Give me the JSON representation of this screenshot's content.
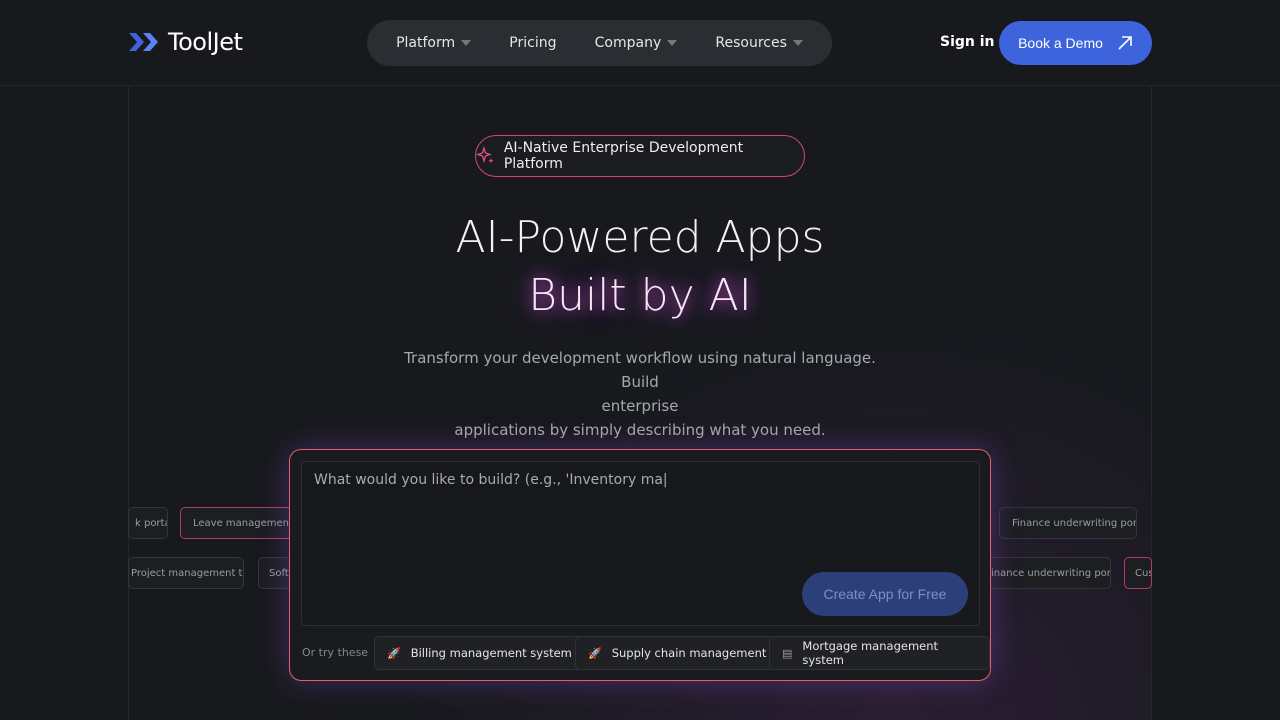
{
  "brand": {
    "name": "ToolJet",
    "accent": "#3d63dd"
  },
  "nav": {
    "items": [
      {
        "label": "Platform",
        "dropdown": true
      },
      {
        "label": "Pricing",
        "dropdown": false
      },
      {
        "label": "Company",
        "dropdown": true
      },
      {
        "label": "Resources",
        "dropdown": true
      }
    ],
    "signin": "Sign in",
    "demo": "Book a Demo"
  },
  "hero": {
    "badge": "AI-Native Enterprise Development Platform",
    "title1": "AI-Powered Apps",
    "title2": "Built by AI",
    "subtitle_line1": "Transform your development workflow using natural language. Build",
    "subtitle_line2": "enterprise",
    "subtitle_line3": "applications by simply describing what you need."
  },
  "chips": {
    "left_row1": [
      "k portal",
      "Leave management system"
    ],
    "left_row2": [
      "Project management tool",
      "Software"
    ],
    "right_row1": [
      "Finance underwriting portal"
    ],
    "right_row2": [
      "inance underwriting portal",
      "Customer"
    ]
  },
  "prompt": {
    "value": "What would you like to build? (e.g., 'Inventory ma|",
    "create": "Create App for Free",
    "try_label": "Or try these",
    "suggestions": [
      {
        "label": "Billing management system",
        "icon": "rocket-icon"
      },
      {
        "label": "Supply chain management",
        "icon": "rocket-icon"
      },
      {
        "label": "Mortgage management system",
        "icon": "database-icon"
      }
    ]
  }
}
